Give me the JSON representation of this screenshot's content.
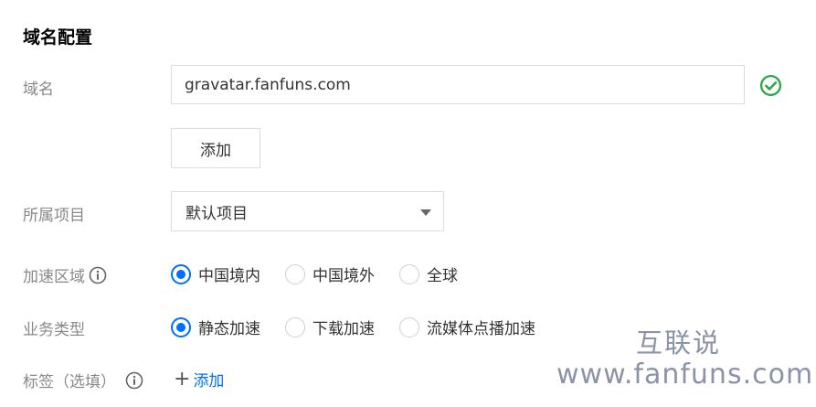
{
  "section_title": "域名配置",
  "domain": {
    "label": "域名",
    "value": "gravatar.fanfuns.com",
    "valid_icon": "check-circle-icon",
    "valid_color": "#29a745",
    "add_button": "添加"
  },
  "project": {
    "label": "所属项目",
    "selected": "默认项目"
  },
  "region": {
    "label": "加速区域",
    "options": [
      "中国境内",
      "中国境外",
      "全球"
    ],
    "selected": "中国境内"
  },
  "business_type": {
    "label": "业务类型",
    "options": [
      "静态加速",
      "下载加速",
      "流媒体点播加速"
    ],
    "selected": "静态加速"
  },
  "tags": {
    "label": "标签（选填）",
    "add_label": "添加"
  },
  "watermark": {
    "cn": "互联说",
    "url": "www.fanfuns.com"
  },
  "accent_color": "#006eff"
}
